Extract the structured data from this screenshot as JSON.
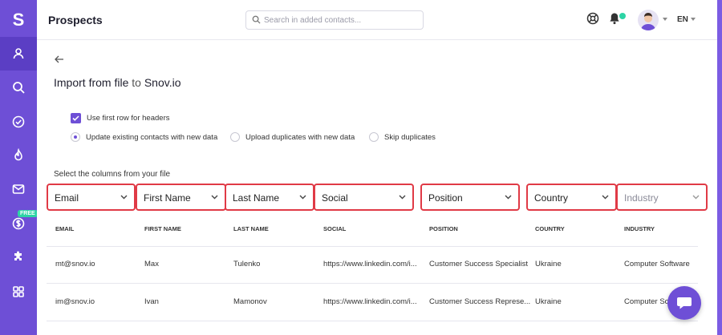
{
  "sidebar": {
    "logo": "S",
    "free_badge": "FREE",
    "items": [
      {
        "icon": "user-icon",
        "active": true
      },
      {
        "icon": "search-icon"
      },
      {
        "icon": "check-circle-icon"
      },
      {
        "icon": "flame-icon"
      },
      {
        "icon": "mail-icon"
      },
      {
        "icon": "dollar-icon"
      },
      {
        "icon": "puzzle-icon"
      },
      {
        "icon": "grid-icon"
      }
    ]
  },
  "header": {
    "title": "Prospects",
    "search_placeholder": "Search in added contacts...",
    "language": "EN"
  },
  "import": {
    "title_prefix": "Import from file ",
    "title_to": "to",
    "title_suffix": " Snov.io",
    "use_first_row": "Use first row for headers",
    "options": [
      {
        "label": "Update existing contacts with new data",
        "selected": true
      },
      {
        "label": "Upload duplicates with new data",
        "selected": false
      },
      {
        "label": "Skip duplicates",
        "selected": false
      }
    ],
    "columns_label": "Select the columns from your file"
  },
  "selects": [
    "Email",
    "First Name",
    "Last Name",
    "Social",
    "Position",
    "Country",
    "Industry"
  ],
  "table": {
    "headers": [
      "EMAIL",
      "FIRST NAME",
      "LAST NAME",
      "SOCIAL",
      "POSITION",
      "COUNTRY",
      "INDUSTRY"
    ],
    "rows": [
      [
        "mt@snov.io",
        "Max",
        "Tulenko",
        "https://www.linkedin.com/i...",
        "Customer Success Specialist",
        "Ukraine",
        "Computer Software"
      ],
      [
        "im@snov.io",
        "Ivan",
        "Mamonov",
        "https://www.linkedin.com/i...",
        "Customer Success Represe...",
        "Ukraine",
        "Computer Sof"
      ]
    ]
  },
  "colors": {
    "accent": "#6e4fd6",
    "highlight": "#e03a46",
    "online": "#2dd4a5"
  }
}
